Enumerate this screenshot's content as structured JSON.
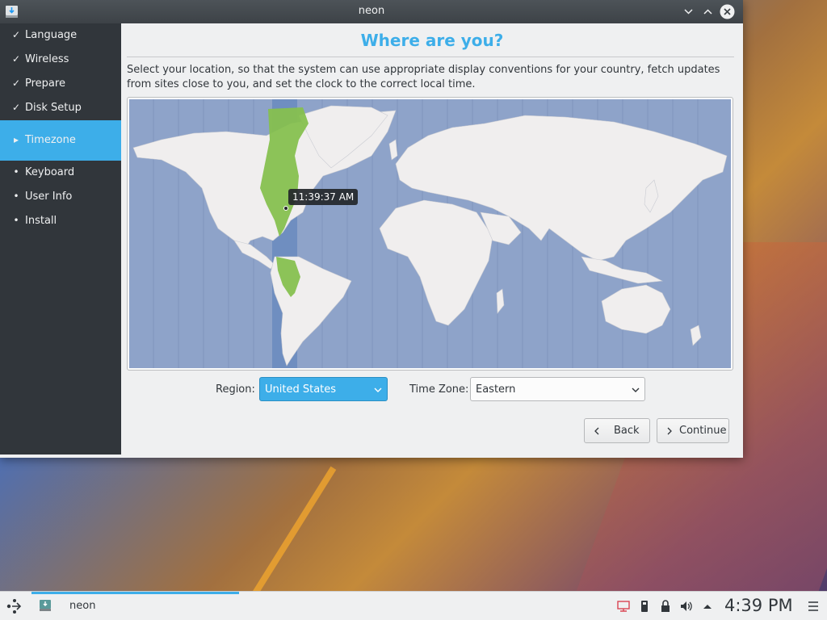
{
  "window": {
    "title": "neon",
    "controls": [
      "minimize",
      "maximize",
      "close"
    ]
  },
  "sidebar": {
    "items": [
      {
        "label": "Language",
        "state": "done",
        "mark": "✓"
      },
      {
        "label": "Wireless",
        "state": "done",
        "mark": "✓"
      },
      {
        "label": "Prepare",
        "state": "done",
        "mark": "✓"
      },
      {
        "label": "Disk Setup",
        "state": "done",
        "mark": "✓"
      },
      {
        "label": "Timezone",
        "state": "current",
        "mark": "▸"
      },
      {
        "label": "Keyboard",
        "state": "pending",
        "mark": "•"
      },
      {
        "label": "User Info",
        "state": "pending",
        "mark": "•"
      },
      {
        "label": "Install",
        "state": "pending",
        "mark": "•"
      }
    ]
  },
  "page": {
    "heading": "Where are you?",
    "description": "Select your location, so that the system can use appropriate display conventions for your country, fetch updates from sites close to you, and set the clock to the correct local time.",
    "map_tooltip": "11:39:37 AM"
  },
  "region": {
    "label": "Region:",
    "value": "United States"
  },
  "timezone": {
    "label": "Time Zone:",
    "value": "Eastern"
  },
  "buttons": {
    "back": "Back",
    "continue": "Continue"
  },
  "taskbar": {
    "task_label": "neon",
    "clock": "4:39 PM"
  },
  "colors": {
    "accent": "#3daee9",
    "sidebar": "#31363b",
    "map_ocean": "#8ea3c9",
    "map_land": "#f0eeee",
    "timezone_highlight": "#86c04f"
  }
}
